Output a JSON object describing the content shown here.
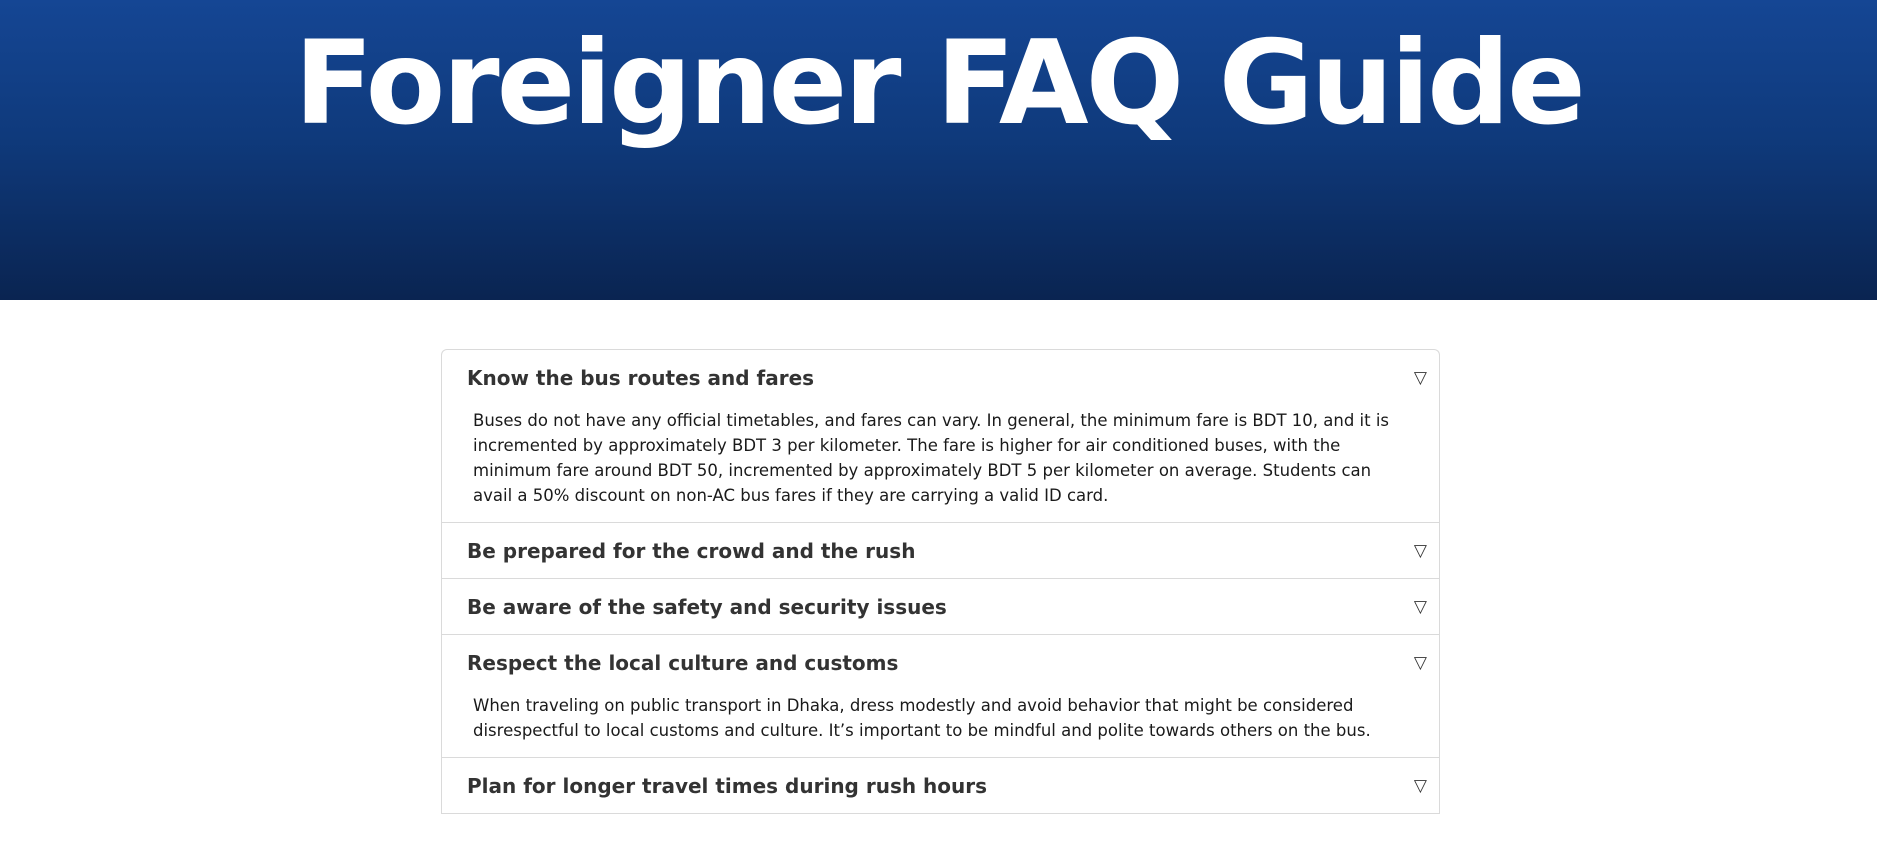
{
  "hero": {
    "title": "Foreigner FAQ Guide"
  },
  "toggle_glyph": "▽",
  "faq": {
    "items": [
      {
        "question": "Know the bus routes and fares",
        "answer": "Buses do not have any official timetables, and fares can vary. In general, the minimum fare is BDT 10, and it is incremented by approximately BDT 3 per kilometer. The fare is higher for air conditioned buses, with the minimum fare around BDT 50, incremented by approximately BDT 5 per kilometer on average. Students can avail a 50% discount on non-AC bus fares if they are carrying a valid ID card.",
        "expanded": true
      },
      {
        "question": "Be prepared for the crowd and the rush",
        "expanded": false
      },
      {
        "question": "Be aware of the safety and security issues",
        "expanded": false
      },
      {
        "question": "Respect the local culture and customs",
        "answer": "When traveling on public transport in Dhaka, dress modestly and avoid behavior that might be considered disrespectful to local customs and culture. It’s important to be mindful and polite towards others on the bus.",
        "expanded": true
      },
      {
        "question": "Plan for longer travel times during rush hours",
        "expanded": false
      }
    ]
  },
  "colors": {
    "hero_top": "#154694",
    "hero_bottom": "#0a2451",
    "border": "#dadada",
    "question_text": "#333333"
  }
}
